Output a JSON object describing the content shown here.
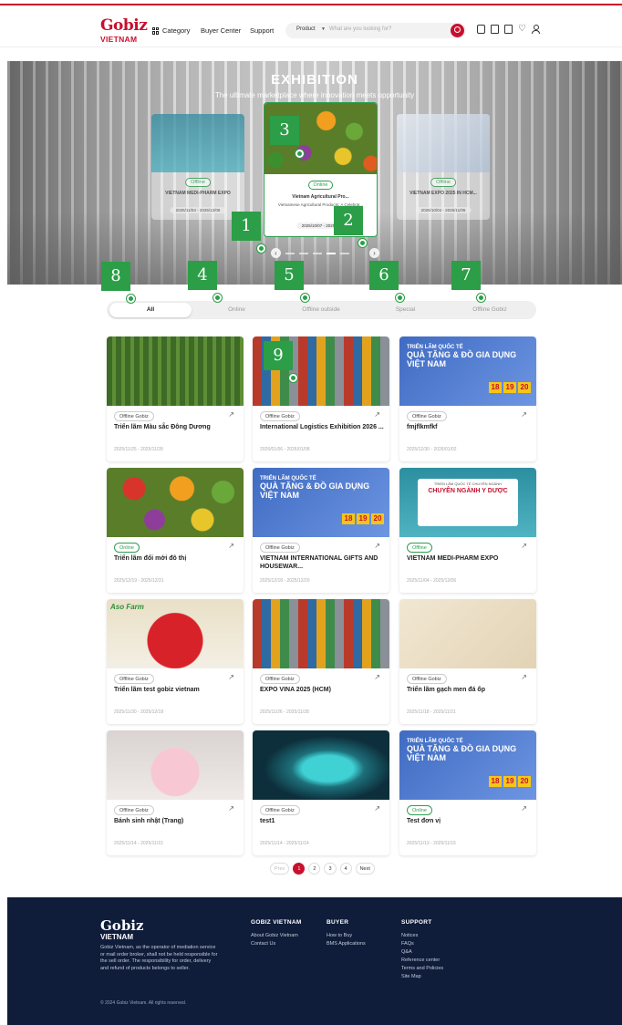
{
  "header": {
    "logo_main": "Gobiz",
    "logo_sub": "VIETNAM",
    "nav": {
      "category": "Category",
      "buyer_center": "Buyer Center",
      "support": "Support"
    },
    "search": {
      "scope": "Product",
      "placeholder": "What are you looking for?"
    },
    "icons": [
      "chat-icon",
      "bag-icon",
      "document-icon",
      "heart-icon",
      "user-icon"
    ],
    "accent_color": "#c8102e"
  },
  "hero": {
    "title": "EXHIBITION",
    "subtitle": "The ultimate marketplace where innovation meets opportunity",
    "slides": {
      "left": {
        "badge": "Offline",
        "title": "VIETNAM MEDI-PHARM EXPO",
        "date": "2025/11/04 - 2025/12/06"
      },
      "center": {
        "badge": "Online",
        "title": "Vietnam Agricultural Pro...",
        "description": "Vietnamese Agricultural Products: A Celebrat...",
        "date": "2025/10/07 - 2025/..."
      },
      "right": {
        "badge": "Offline",
        "title": "VIETNAM EXPO 2025 IN HCM...",
        "date": "2025/10/04 - 2025/11/06"
      }
    },
    "carousel_dots": 5,
    "active_dot": 3
  },
  "filters": {
    "tabs": [
      "All",
      "Online",
      "Offline outside",
      "Special",
      "Offline Gobiz"
    ],
    "active": "All"
  },
  "markers": [
    "1",
    "2",
    "3",
    "4",
    "5",
    "6",
    "7",
    "8",
    "9"
  ],
  "cards": [
    {
      "tag": "Offline Gobiz",
      "title": "Triển lãm Màu sắc Đông Dương",
      "date": "2025/11/25 - 2025/11/28",
      "image": "strawberry-farm"
    },
    {
      "tag": "Offline Gobiz",
      "title": "International Logistics Exhibition 2026 ...",
      "date": "2026/01/06 - 2026/01/08",
      "image": "container-port"
    },
    {
      "tag": "Offline Gobiz",
      "title": "fmjflkmfkf",
      "date": "2025/12/30 - 2026/01/02",
      "image": "gift-expo-banner"
    },
    {
      "tag": "Online",
      "title": "Triển lãm đổi mới đô thị",
      "date": "2025/12/19 - 2025/12/31",
      "image": "vegetables"
    },
    {
      "tag": "Offline Gobiz",
      "title": "VIETNAM INTERNATIONAL GIFTS AND HOUSEWAR...",
      "date": "2025/12/18 - 2025/12/20",
      "image": "gift-expo-banner"
    },
    {
      "tag": "Offline",
      "title": "VIETNAM MEDI-PHARM EXPO",
      "date": "2025/11/04 - 2025/12/06",
      "image": "pharm-banner"
    },
    {
      "tag": "Offline Gobiz",
      "title": "Triển lãm test gobiz vietnam",
      "date": "2025/11/30 - 2025/12/18",
      "image": "aso-farm-strawberries"
    },
    {
      "tag": "Offline Gobiz",
      "title": "EXPO VINA 2025 (HCM)",
      "date": "2025/11/26 - 2025/11/28",
      "image": "container-port"
    },
    {
      "tag": "Offline Gobiz",
      "title": "Triển lãm gạch men đá ốp",
      "date": "2025/11/18 - 2025/11/21",
      "image": "cosmetics"
    },
    {
      "tag": "Offline Gobiz",
      "title": "Bánh sinh nhật (Trang)",
      "date": "2025/11/14 - 2025/11/15",
      "image": "birthday-cake"
    },
    {
      "tag": "Offline Gobiz",
      "title": "test1",
      "date": "2025/11/14 - 2025/11/14",
      "image": "neon-face"
    },
    {
      "tag": "Online",
      "title": "Test đơn vị",
      "date": "2025/11/13 - 2025/11/15",
      "image": "gift-expo-banner"
    }
  ],
  "banner_text": {
    "gift_line1": "TRIỂN LÃM QUỐC TẾ",
    "gift_line2": "QUÀ TẶNG & ĐỒ GIA DỤNG VIỆT NAM",
    "gift_line3": "VIETNAM INTERNATIONAL GIFTS & HOUSEWARES",
    "gift_days": [
      "18",
      "19",
      "20"
    ],
    "pharm_line1": "TRIỂN LÃM QUỐC TẾ CHUYÊN NGÀNH",
    "pharm_line2": "CHUYÊN NGÀNH Y DƯỢC",
    "aso": "Aso Farm"
  },
  "pagination": {
    "prev": "Prev",
    "pages": [
      "1",
      "2",
      "3",
      "4"
    ],
    "current": "1",
    "next": "Next"
  },
  "footer": {
    "logo_main": "Gobiz",
    "logo_sub": "VIETNAM",
    "description": "Gobiz Vietnam, as the operator of mediation service or mail order broker, shall not be held responsible for the sell order. The responsibility for order, delivery and refund of products belongs to seller.",
    "copyright": "© 2024 Gobiz Vietnam. All rights reserved.",
    "columns": [
      {
        "title": "GOBIZ VIETNAM",
        "links": [
          "About Gobiz Vietnam",
          "Contact Us"
        ]
      },
      {
        "title": "BUYER",
        "links": [
          "How to Buy",
          "BMS Applications"
        ]
      },
      {
        "title": "SUPPORT",
        "links": [
          "Notices",
          "FAQs",
          "Q&A",
          "Reference center",
          "Terms and Policies",
          "Site Map"
        ]
      }
    ]
  }
}
